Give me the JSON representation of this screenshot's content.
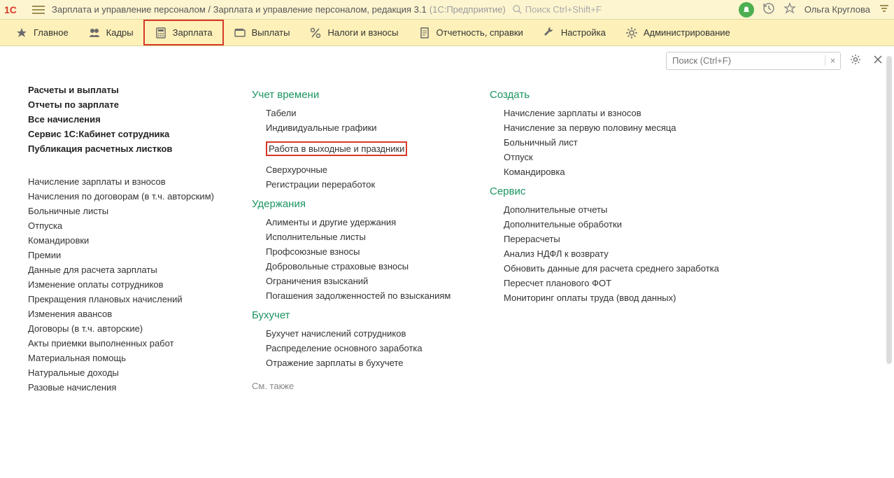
{
  "titlebar": {
    "title": "Зарплата и управление персоналом / Зарплата и управление персоналом, редакция 3.1",
    "context": "(1С:Предприятие)",
    "search_placeholder": "Поиск Ctrl+Shift+F",
    "user": "Ольга Круглова"
  },
  "nav": {
    "items": [
      {
        "label": "Главное",
        "icon": "star"
      },
      {
        "label": "Кадры",
        "icon": "people"
      },
      {
        "label": "Зарплата",
        "icon": "calc",
        "active": true
      },
      {
        "label": "Выплаты",
        "icon": "wallet"
      },
      {
        "label": "Налоги и взносы",
        "icon": "percent"
      },
      {
        "label": "Отчетность, справки",
        "icon": "report"
      },
      {
        "label": "Настройка",
        "icon": "wrench"
      },
      {
        "label": "Администрирование",
        "icon": "gear"
      }
    ]
  },
  "subtoolbar": {
    "search_placeholder": "Поиск (Ctrl+F)"
  },
  "col1": {
    "bold_links": [
      "Расчеты и выплаты",
      "Отчеты по зарплате",
      "Все начисления",
      "Сервис 1С:Кабинет сотрудника",
      "Публикация расчетных листков"
    ],
    "links": [
      "Начисление зарплаты и взносов",
      "Начисления по договорам (в т.ч. авторским)",
      "Больничные листы",
      "Отпуска",
      "Командировки",
      "Премии",
      "Данные для расчета зарплаты",
      "Изменение оплаты сотрудников",
      "Прекращения плановых начислений",
      "Изменения авансов",
      "Договоры (в т.ч. авторские)",
      "Акты приемки выполненных работ",
      "Материальная помощь",
      "Натуральные доходы",
      "Разовые начисления"
    ]
  },
  "col2": {
    "sec1_title": "Учет времени",
    "sec1_links": [
      "Табели",
      "Индивидуальные графики",
      "Работа в выходные и праздники",
      "Сверхурочные",
      "Регистрации переработок"
    ],
    "sec2_title": "Удержания",
    "sec2_links": [
      "Алименты и другие удержания",
      "Исполнительные листы",
      "Профсоюзные взносы",
      "Добровольные страховые взносы",
      "Ограничения взысканий",
      "Погашения задолженностей по взысканиям"
    ],
    "sec3_title": "Бухучет",
    "sec3_links": [
      "Бухучет начислений сотрудников",
      "Распределение основного заработка",
      "Отражение зарплаты в бухучете"
    ],
    "see_also": "См. также"
  },
  "col3": {
    "sec1_title": "Создать",
    "sec1_links": [
      "Начисление зарплаты и взносов",
      "Начисление за первую половину месяца",
      "Больничный лист",
      "Отпуск",
      "Командировка"
    ],
    "sec2_title": "Сервис",
    "sec2_links": [
      "Дополнительные отчеты",
      "Дополнительные обработки",
      "Перерасчеты",
      "Анализ НДФЛ к возврату",
      "Обновить данные для расчета среднего заработка",
      "Пересчет планового ФОТ",
      "Мониторинг оплаты труда (ввод данных)"
    ]
  }
}
